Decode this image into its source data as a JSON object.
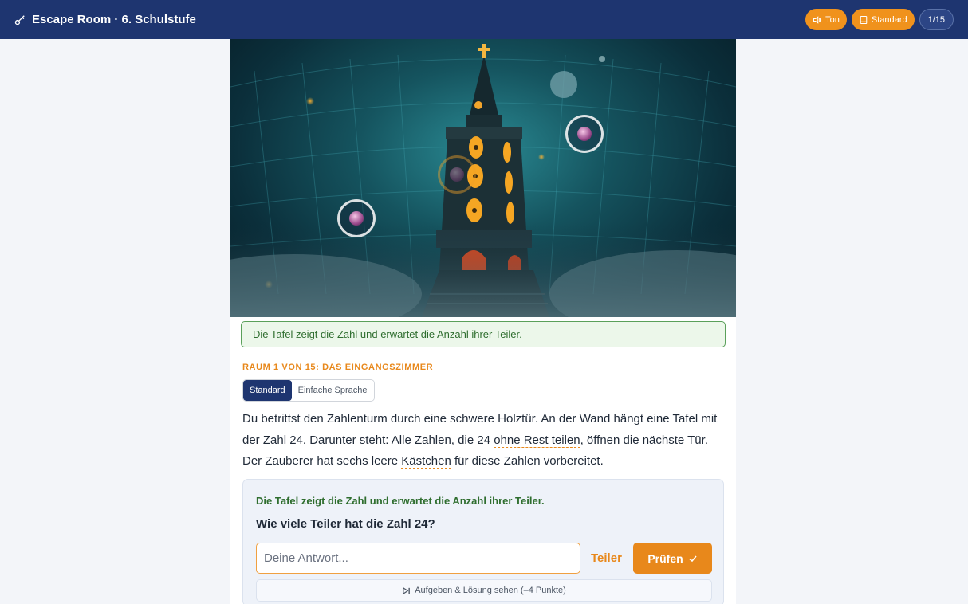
{
  "header": {
    "title": "Escape Room · 6. Schulstufe",
    "sound_label": "Ton",
    "mode_label": "Standard",
    "progress_label": "1/15"
  },
  "scene": {
    "hint": "Die Tafel zeigt die Zahl und erwartet die Anzahl ihrer Teiler."
  },
  "room": {
    "label": "RAUM 1 VON 15: DAS EINGANGSZIMMER",
    "language_options": [
      "Standard",
      "Einfache Sprache"
    ],
    "language_selected": "Standard"
  },
  "story": {
    "part1": "Du betrittst den Zahlenturm durch eine schwere Holztür. An der Wand hängt eine ",
    "term1": "Tafel",
    "part2": " mit der Zahl 24. Darunter steht: Alle Zahlen, die 24 ",
    "term2": "ohne Rest teilen",
    "part3": ", öffnen die nächste Tür. Der Zauberer hat sechs leere ",
    "term3": "Kästchen",
    "part4": " für diese Zahlen vorbereitet."
  },
  "task": {
    "hint": "Die Tafel zeigt die Zahl und erwartet die Anzahl ihrer Teiler.",
    "question": "Wie viele Teiler hat die Zahl 24?",
    "input_placeholder": "Deine Antwort...",
    "input_value": "",
    "unit": "Teiler",
    "check_label": "Prüfen",
    "giveup_label": "Aufgeben & Lösung sehen (–4 Punkte)"
  },
  "colors": {
    "header_bg": "#1e3570",
    "accent": "#e8881b",
    "success": "#2f6e2f"
  },
  "icons": {
    "brand": "key-icon",
    "sound": "speaker-icon",
    "mode": "book-icon",
    "check": "checkmark-icon",
    "giveup": "skip-icon"
  }
}
